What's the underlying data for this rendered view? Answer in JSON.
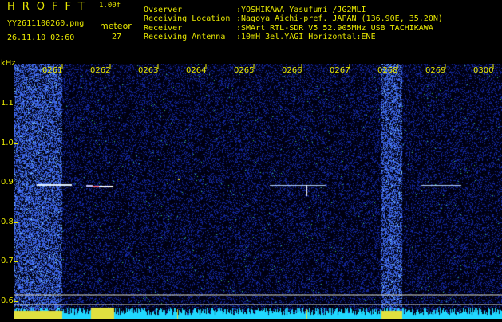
{
  "app": {
    "title": "HROFFT",
    "version": "1.00f"
  },
  "file": {
    "name": "YY2611100260.png",
    "timestamp": "26.11.10 02:60"
  },
  "meteor": {
    "label": "meteor",
    "count": "27"
  },
  "station": [
    {
      "label": "Ovserver",
      "value": ":YOSHIKAWA Yasufumi /JG2MLI"
    },
    {
      "label": "Receiving Location",
      "value": ":Nagoya Aichi-pref. JAPAN (136.90E, 35.20N)"
    },
    {
      "label": "Receiver",
      "value": ":SMArt RTL-SDR V5 52.905MHz USB TACHIKAWA"
    },
    {
      "label": "Receiving Antenna",
      "value": ":10mH 3el.YAGI Horizontal:ENE"
    }
  ],
  "axis": {
    "unit": "kHz",
    "y_ticks": [
      "1.1",
      "1.0",
      "0.9",
      "0.8",
      "0.7",
      "0.6"
    ],
    "x_ticks": [
      "0261",
      "0262",
      "0263",
      "0264",
      "0265",
      "0266",
      "0267",
      "0268",
      "0269",
      "0300"
    ]
  },
  "colors": {
    "label": "#e8e800",
    "background": "#000010",
    "noise": "#1a2a8a",
    "bright": "#e0e040"
  }
}
